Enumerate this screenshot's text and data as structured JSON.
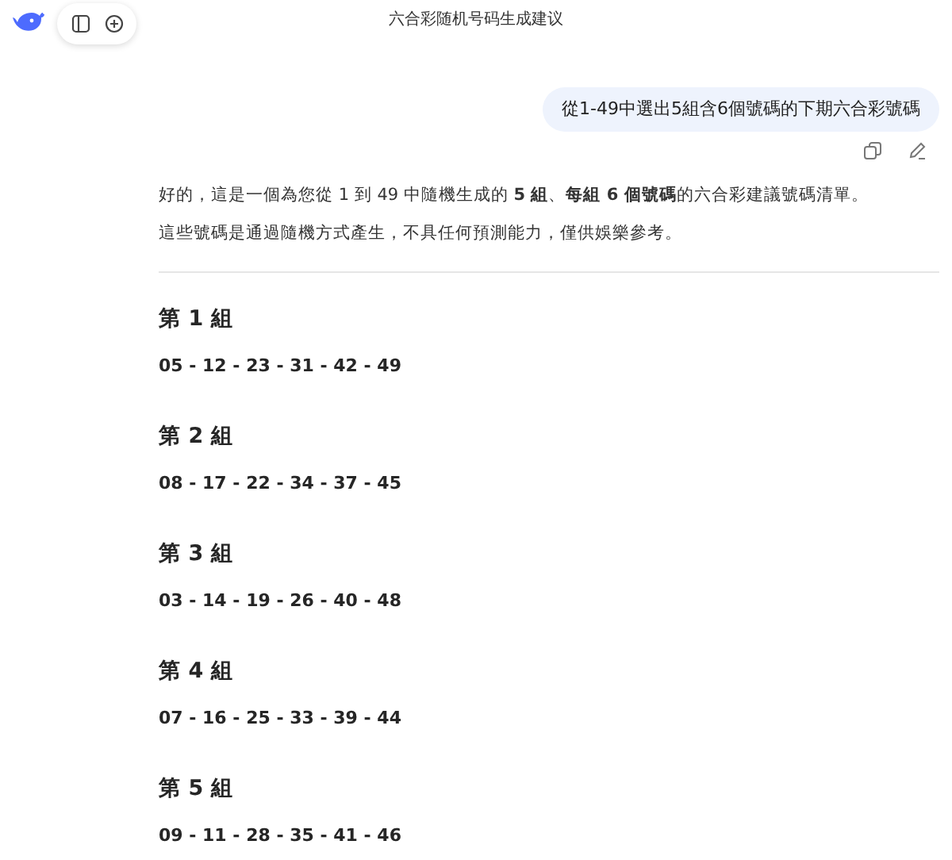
{
  "header": {
    "title": "六合彩随机号码生成建议"
  },
  "user_message": {
    "text": "從1-49中選出5組含6個號碼的下期六合彩號碼"
  },
  "answer": {
    "paragraphs": [
      "好的，這是一個為您從 1 到 49 中隨機生成的 **5 組**、**每組 6 個號碼**的六合彩建議號碼清單。",
      "這些號碼是通過隨機方式產生，不具任何預測能力，僅供娛樂參考。"
    ],
    "groups": [
      {
        "heading": "第 1 組",
        "numbers": "05 - 12 - 23 - 31 - 42 - 49"
      },
      {
        "heading": "第 2 組",
        "numbers": "08 - 17 - 22 - 34 - 37 - 45"
      },
      {
        "heading": "第 3 組",
        "numbers": "03 - 14 - 19 - 26 - 40 - 48"
      },
      {
        "heading": "第 4 組",
        "numbers": "07 - 16 - 25 - 33 - 39 - 44"
      },
      {
        "heading": "第 5 組",
        "numbers": "09 - 11 - 28 - 35 - 41 - 46"
      }
    ]
  }
}
